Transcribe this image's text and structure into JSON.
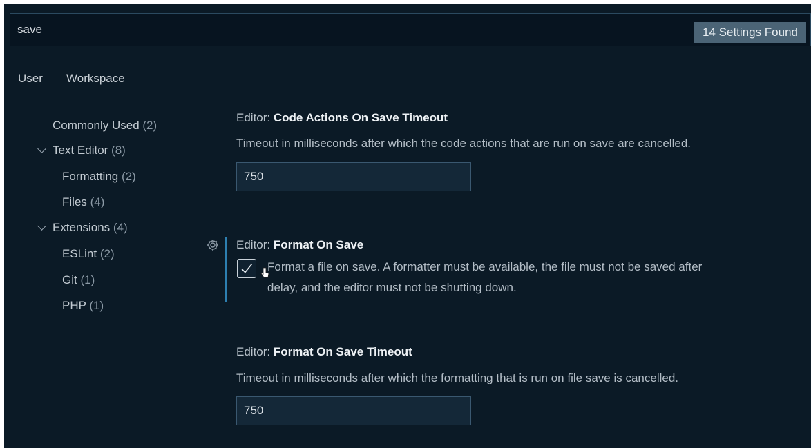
{
  "search": {
    "value": "save",
    "result_count": "14 Settings Found"
  },
  "tabs": [
    {
      "label": "User",
      "active": true
    },
    {
      "label": "Workspace",
      "active": false
    }
  ],
  "tree": {
    "commonly_used": {
      "label": "Commonly Used",
      "count": "(2)"
    },
    "text_editor": {
      "label": "Text Editor",
      "count": "(8)",
      "expanded": true
    },
    "formatting": {
      "label": "Formatting",
      "count": "(2)"
    },
    "files": {
      "label": "Files",
      "count": "(4)"
    },
    "extensions": {
      "label": "Extensions",
      "count": "(4)",
      "expanded": true
    },
    "eslint": {
      "label": "ESLint",
      "count": "(2)"
    },
    "git": {
      "label": "Git",
      "count": "(1)"
    },
    "php": {
      "label": "PHP",
      "count": "(1)"
    }
  },
  "settings": [
    {
      "category": "Editor: ",
      "name": "Code Actions On Save Timeout",
      "description": "Timeout in milliseconds after which the code actions that are run on save are cancelled.",
      "value": "750"
    },
    {
      "category": "Editor: ",
      "name": "Format On Save",
      "description_line1": "Format a file on save. A formatter must be available, the file must not be saved after",
      "description_line2": "delay, and the editor must not be shutting down.",
      "checked": true,
      "modified": true
    },
    {
      "category": "Editor: ",
      "name": "Format On Save Timeout",
      "description": "Timeout in milliseconds after which the formatting that is run on file save is cancelled.",
      "value": "750"
    }
  ],
  "colors": {
    "background": "#0b1a26",
    "accent": "#2d7fb0",
    "badge": "#4b6476"
  },
  "icons": [
    "gear-icon",
    "check-icon",
    "chevron-down-icon",
    "pointer-cursor-icon"
  ]
}
